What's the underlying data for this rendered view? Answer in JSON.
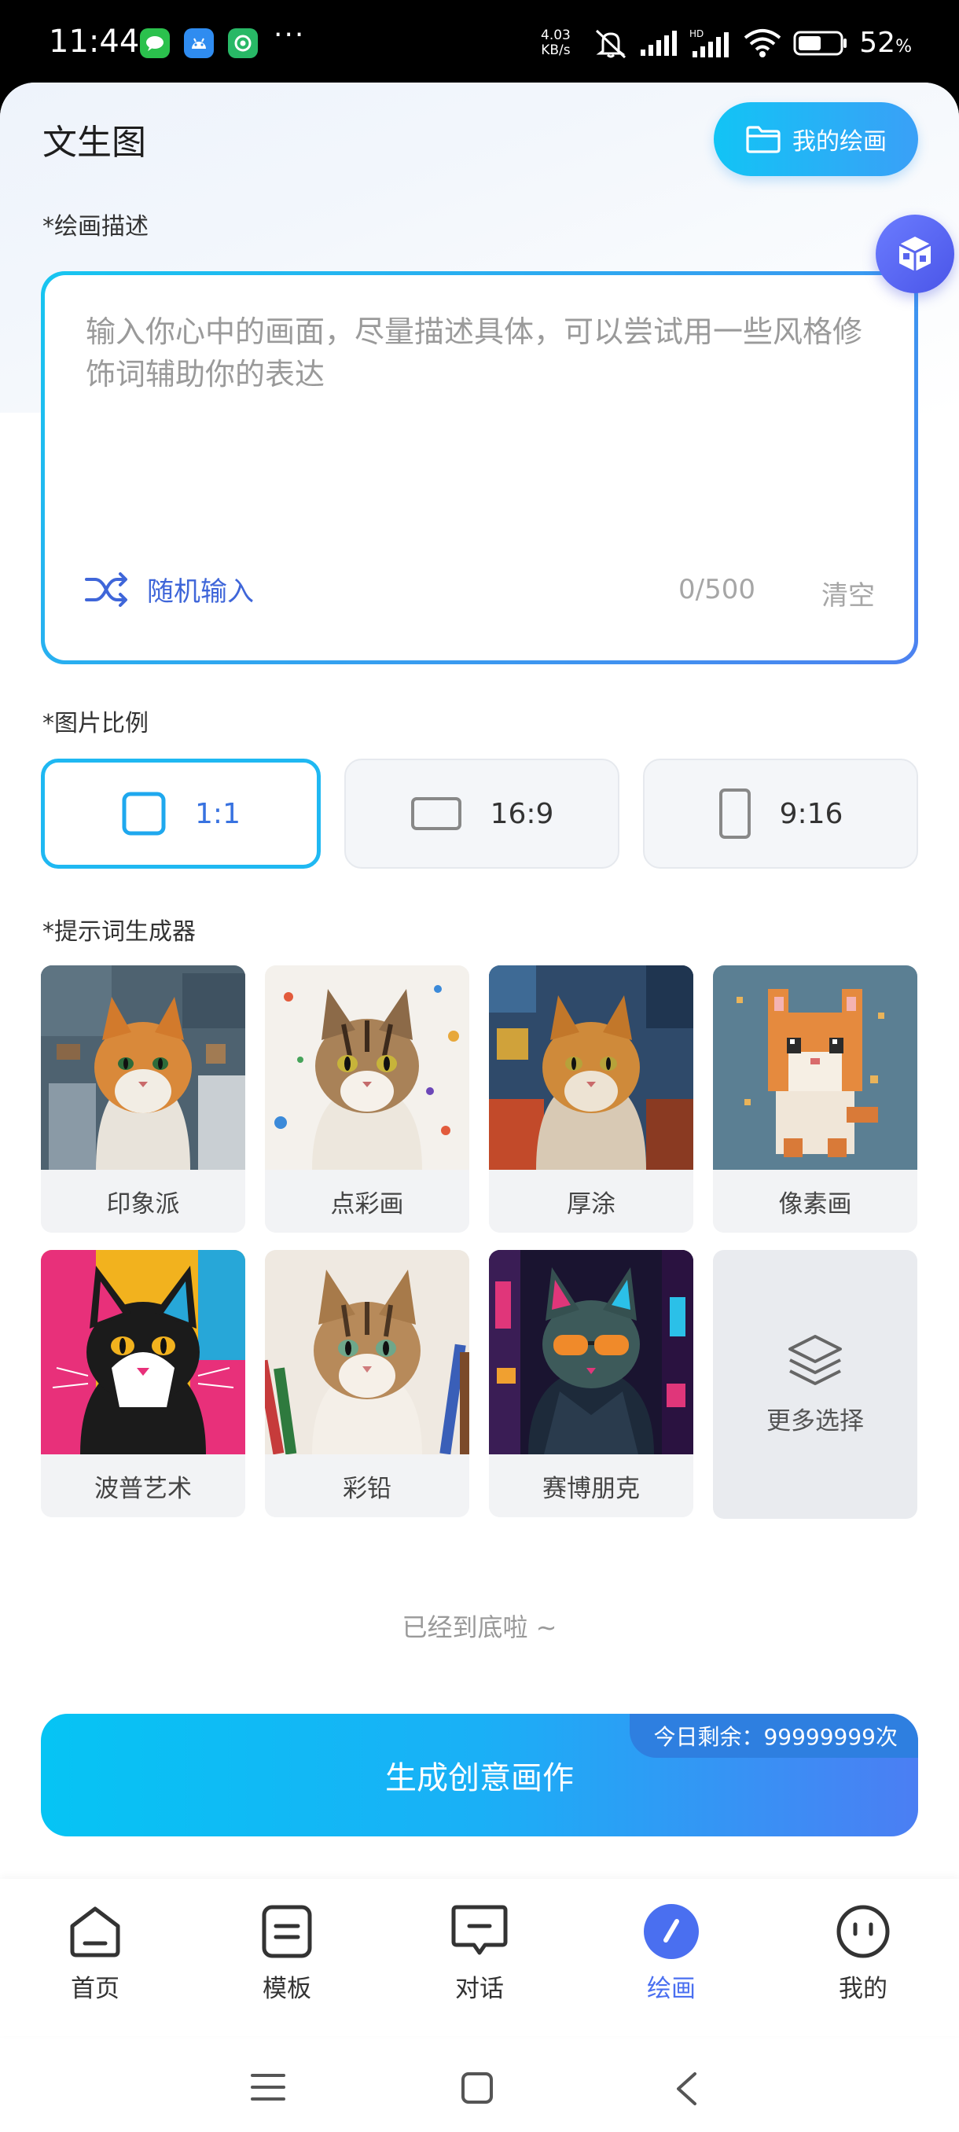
{
  "status_bar": {
    "time": "11:44",
    "more": "···",
    "net_speed_value": "4.03",
    "net_speed_unit": "KB/s",
    "battery_percent": "52",
    "battery_unit": "%"
  },
  "header": {
    "title": "文生图",
    "my_drawings_label": "我的绘画"
  },
  "description": {
    "label": "*绘画描述",
    "placeholder": "输入你心中的画面，尽量描述具体，可以尝试用一些风格修饰词辅助你的表达",
    "random_label": "随机输入",
    "char_count": "0/500",
    "clear_label": "清空"
  },
  "ratio": {
    "label": "*图片比例",
    "options": [
      {
        "label": "1:1",
        "selected": true
      },
      {
        "label": "16:9",
        "selected": false
      },
      {
        "label": "9:16",
        "selected": false
      }
    ]
  },
  "prompt_generator": {
    "label": "*提示词生成器",
    "styles": [
      {
        "label": "印象派"
      },
      {
        "label": "点彩画"
      },
      {
        "label": "厚涂"
      },
      {
        "label": "像素画"
      },
      {
        "label": "波普艺术"
      },
      {
        "label": "彩铅"
      },
      {
        "label": "赛博朋克"
      }
    ],
    "more_label": "更多选择"
  },
  "end_hint": "已经到底啦 ~",
  "generate": {
    "label": "生成创意画作",
    "remaining": "今日剩余：99999999次"
  },
  "tabs": [
    {
      "label": "首页",
      "icon": "home-icon",
      "active": false
    },
    {
      "label": "模板",
      "icon": "template-icon",
      "active": false
    },
    {
      "label": "对话",
      "icon": "chat-icon",
      "active": false
    },
    {
      "label": "绘画",
      "icon": "brush-icon",
      "active": true
    },
    {
      "label": "我的",
      "icon": "profile-icon",
      "active": false
    }
  ],
  "colors": {
    "accent": "#1fb8f2",
    "brand_blue": "#4a6ff0",
    "gradient_start": "#06c4f4",
    "gradient_end": "#4b7ef3"
  }
}
